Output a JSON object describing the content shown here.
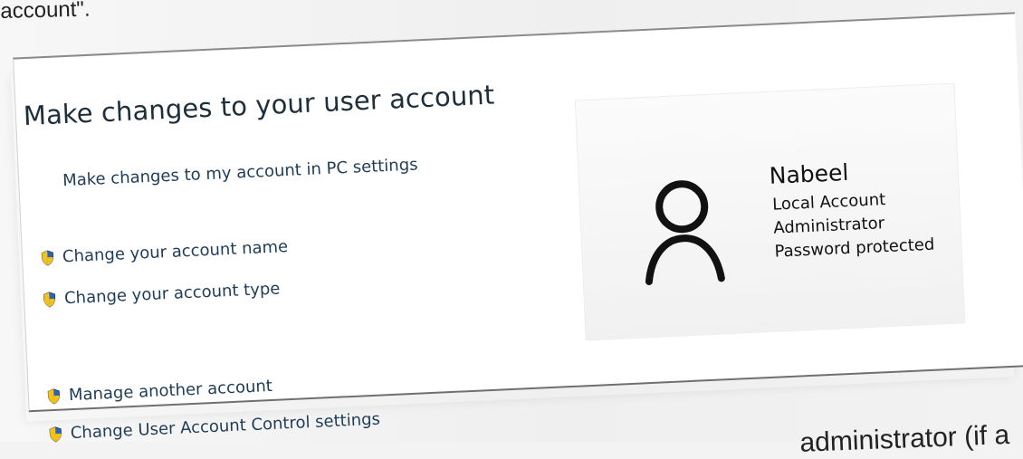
{
  "intro_text": "account\".",
  "panel": {
    "title": "Make changes to your user account",
    "top_link": "Make changes to my account in PC settings",
    "links": [
      {
        "label": "Change your account name",
        "icon": "shield-icon"
      },
      {
        "label": "Change your account type",
        "icon": "shield-icon"
      },
      {
        "label": "Manage another account",
        "icon": "shield-icon"
      },
      {
        "label": "Change User Account Control settings",
        "icon": "shield-icon"
      }
    ]
  },
  "account": {
    "name": "Nabeel",
    "type": "Local Account",
    "role": "Administrator",
    "status": "Password protected",
    "avatar_icon": "user-icon"
  },
  "bottom_text": "administrator (if a",
  "colors": {
    "panel_background": "#ffffff",
    "heading": "#1d2f3b",
    "link": "#1f3c57",
    "shield_blue": "#2b64b8",
    "shield_yellow": "#f2c218",
    "avatar": "#111111"
  }
}
